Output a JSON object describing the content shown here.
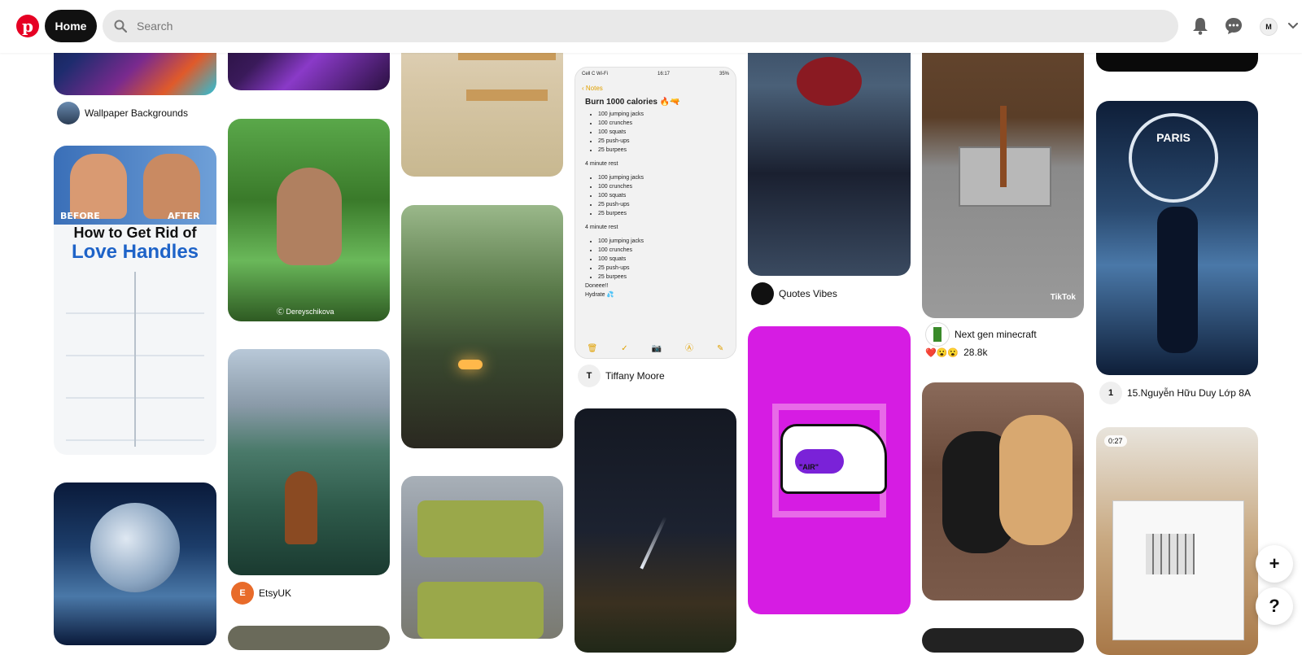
{
  "header": {
    "home_label": "Home",
    "search_placeholder": "Search",
    "avatar_initial": "M"
  },
  "pins": {
    "col1": {
      "meta1_name": "Wallpaper Backgrounds"
    },
    "love_handles": {
      "before": "BEFORE",
      "after": "AFTER",
      "title1": "How to Get Rid of",
      "title2": "Love Handles"
    },
    "deer": {
      "watermark": "Ⓒ Dereyschikova"
    },
    "etsy": {
      "name": "EtsyUK",
      "initial": "E"
    },
    "notes": {
      "status_left": "Cell C Wi-Fi",
      "status_time": "16:17",
      "status_right": "35%",
      "back_label": "Notes",
      "title": "Burn 1000 calories 🔥🔫",
      "block1": [
        "100 jumping jacks",
        "100 crunches",
        "100 squats",
        "25 push-ups",
        "25 burpees"
      ],
      "rest1": "4 minute rest",
      "block2": [
        "100 jumping jacks",
        "100 crunches",
        "100 squats",
        "25 push-ups",
        "25 burpees"
      ],
      "rest2": "4 minute rest",
      "block3": [
        "100 jumping jacks",
        "100 crunches",
        "100 squats",
        "25 push-ups",
        "25 burpees"
      ],
      "done": "Doneee!!",
      "hydrate": "Hydrate 💦"
    },
    "tiffany": {
      "name": "Tiffany Moore",
      "initial": "T"
    },
    "quotes": {
      "name": "Quotes Vibes"
    },
    "minecraft": {
      "name": "Next gen minecraft",
      "reactions": "❤️😮😮",
      "count": "28.8k",
      "tiktok": "TikTok"
    },
    "psg": {
      "name": "15.Nguyễn Hữu Duy Lớp 8A",
      "initial": "1",
      "club": "PARIS"
    },
    "video": {
      "duration": "0:27"
    },
    "sneaker": {
      "text": "\"AIR\""
    }
  },
  "colors": {
    "brand": "#e60023",
    "sneaker_bg": "#d61ce3"
  }
}
